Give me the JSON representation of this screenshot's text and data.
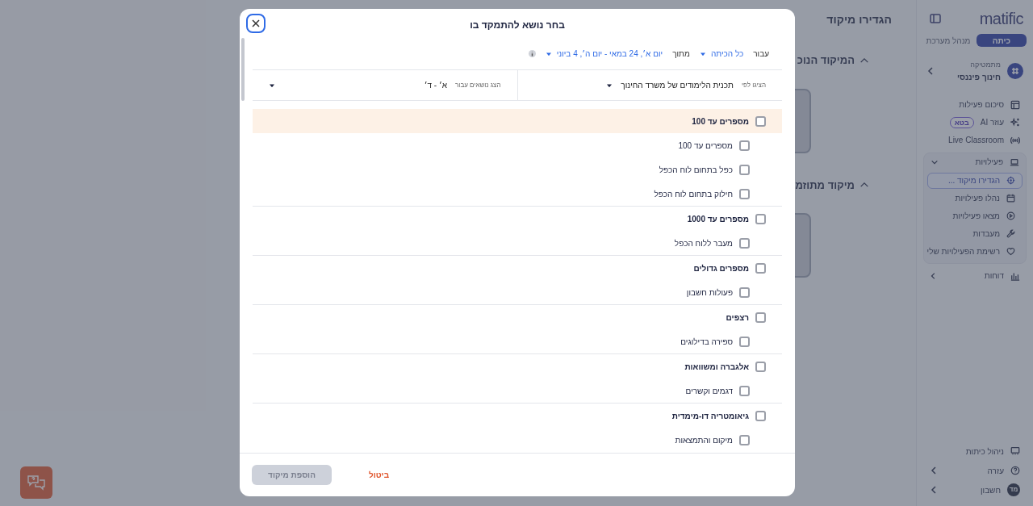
{
  "sidebar": {
    "logo": "matific",
    "role_tabs": [
      {
        "label": "כיתה",
        "selected": true
      },
      {
        "label": "מנהל מערכת",
        "selected": false
      }
    ],
    "class_selector": {
      "subject": "מתמטיקה",
      "name": "חינוך פיננסי"
    },
    "nav": [
      {
        "label": "סיכום פעילות",
        "kind": "link"
      },
      {
        "label": "עוזר AI",
        "kind": "link",
        "badge": "בטא"
      },
      {
        "label": "Live Classroom",
        "kind": "link"
      },
      {
        "label": "פעילויות",
        "kind": "group",
        "expanded": true,
        "children": [
          {
            "label": "הגדירו מיקוד ...",
            "selected": true
          },
          {
            "label": "נהלו פעילויות",
            "selected": false
          },
          {
            "label": "מצאו פעילויות",
            "selected": false
          },
          {
            "label": "מעבדות",
            "selected": false
          },
          {
            "label": "רשימת הפעילויות שלי",
            "selected": false
          }
        ]
      },
      {
        "label": "דוחות",
        "kind": "group",
        "expanded": false
      }
    ],
    "bottom_nav": [
      {
        "label": "ניהול כיתות",
        "kind": "link"
      },
      {
        "label": "עזרה",
        "kind": "menu"
      },
      {
        "label": "חשבון",
        "kind": "account",
        "avatar": "מד"
      }
    ]
  },
  "main": {
    "title": "הגדירו מיקוד",
    "sections": [
      {
        "heading": "המיקוד הנוכ",
        "expanded": true
      },
      {
        "heading": "מיקוד מתוזמ",
        "expanded": true
      }
    ]
  },
  "dialog": {
    "title": "בחר נושא להתמקד בו",
    "filters": {
      "for_label": "עבור",
      "audience": "כל הכיתה",
      "range_label": "מתוך",
      "date_range": "יום א׳, 24 במאי - יום ה׳, 4 ביוני"
    },
    "selectors": [
      {
        "label": "הציגו לפי",
        "value": "תכנית הלימודים של משרד החינוך"
      },
      {
        "label": "הצג נושאים עבור",
        "value": "א׳ - ד׳"
      }
    ],
    "topics": [
      {
        "label": "מספרים עד 100",
        "checked": false,
        "highlighted": true,
        "children": [
          {
            "label": "מספרים עד 100",
            "checked": false
          },
          {
            "label": "כפל בתחום לוח הכפל",
            "checked": false
          },
          {
            "label": "חילוק בתחום לוח הכפל",
            "checked": false
          }
        ]
      },
      {
        "label": "מספרים עד 1000",
        "checked": false,
        "highlighted": false,
        "children": [
          {
            "label": "מעבר ללוח הכפל",
            "checked": false
          }
        ]
      },
      {
        "label": "מספרים גדולים",
        "checked": false,
        "highlighted": false,
        "children": [
          {
            "label": "פעולות חשבון",
            "checked": false
          }
        ]
      },
      {
        "label": "רצפים",
        "checked": false,
        "highlighted": false,
        "children": [
          {
            "label": "ספירה בדילוגים",
            "checked": false
          }
        ]
      },
      {
        "label": "אלגברה ומשוואות",
        "checked": false,
        "highlighted": false,
        "children": [
          {
            "label": "דגמים וקשרים",
            "checked": false
          }
        ]
      },
      {
        "label": "גיאומטריה דו-מימדית",
        "checked": false,
        "highlighted": false,
        "children": [
          {
            "label": "מיקום והתמצאות",
            "checked": false
          }
        ]
      }
    ],
    "buttons": [
      {
        "label": "ביטול",
        "kind": "cancel"
      },
      {
        "label": "הוספת מיקוד",
        "kind": "primary",
        "disabled": true
      }
    ]
  }
}
